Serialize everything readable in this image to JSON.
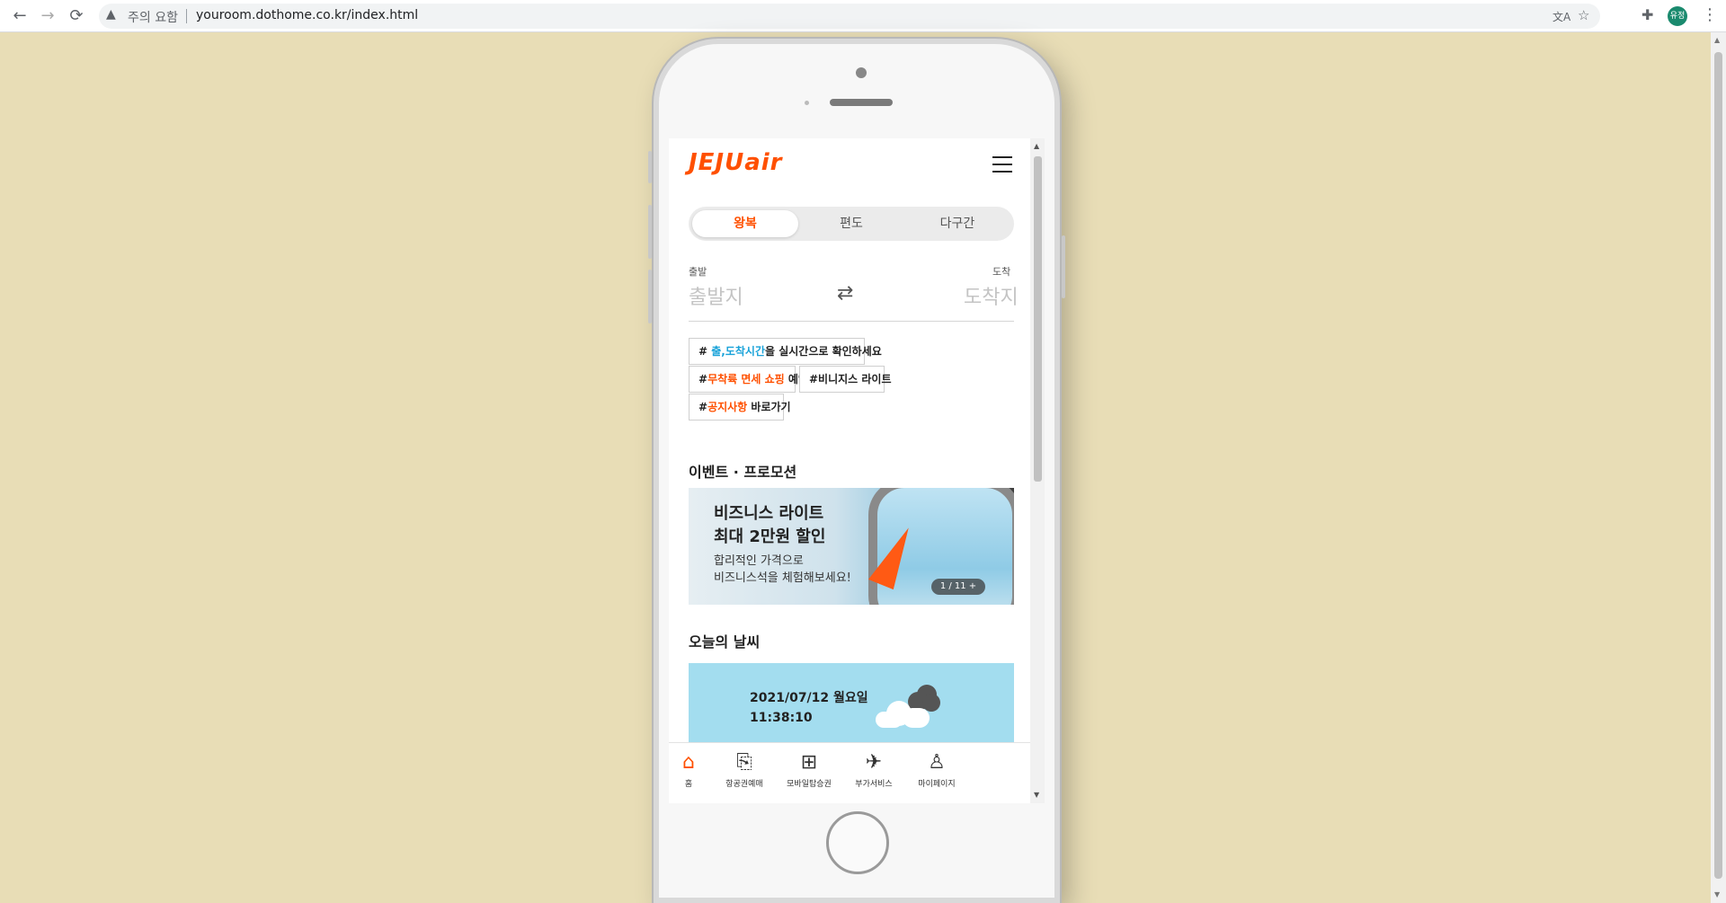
{
  "browser": {
    "security_warning": "주의 요함",
    "url": "youroom.dothome.co.kr/index.html",
    "profile_initials": "유정"
  },
  "app": {
    "logo": "JEJUair",
    "trip_tabs": [
      {
        "label": "왕복",
        "active": true
      },
      {
        "label": "편도",
        "active": false
      },
      {
        "label": "다구간",
        "active": false
      }
    ],
    "route": {
      "from_label": "출발",
      "from_placeholder": "출발지",
      "to_label": "도착",
      "to_placeholder": "도착지"
    },
    "hashtags": [
      {
        "prefix": "# ",
        "highlight": "출,도착시간",
        "suffix": "을 실시간으로 확인하세요",
        "color": "#1aa3d9"
      },
      {
        "prefix": "#",
        "highlight": "무착륙 면세 쇼핑",
        "suffix": " 예약",
        "color": "#ff5000"
      },
      {
        "prefix": "#비니지스 라이트",
        "highlight": "",
        "suffix": "",
        "color": "#222222"
      },
      {
        "prefix": "#",
        "highlight": "공지사항",
        "suffix": " 바로가기",
        "color": "#ff5000"
      }
    ],
    "events_title": "이벤트 · 프로모션",
    "promo": {
      "title_line1": "비즈니스 라이트",
      "title_line2": "최대 2만원 할인",
      "sub_line1": "합리적인 가격으로",
      "sub_line2": "비즈니스석을 체험해보세요!",
      "counter": "1 / 11  +"
    },
    "weather_title": "오늘의 날씨",
    "weather": {
      "date": "2021/07/12 월요일",
      "time": "11:38:10"
    },
    "bottom_nav": [
      {
        "label": "홈",
        "icon": "home-icon",
        "active": true
      },
      {
        "label": "항공권예매",
        "icon": "ticket-icon",
        "active": false
      },
      {
        "label": "모바일탑승권",
        "icon": "qr-code-icon",
        "active": false
      },
      {
        "label": "부가서비스",
        "icon": "plane-plus-icon",
        "active": false
      },
      {
        "label": "마이페이지",
        "icon": "person-icon",
        "active": false
      }
    ],
    "brand_color": "#ff5000",
    "page_background": "#e8ddb6"
  }
}
